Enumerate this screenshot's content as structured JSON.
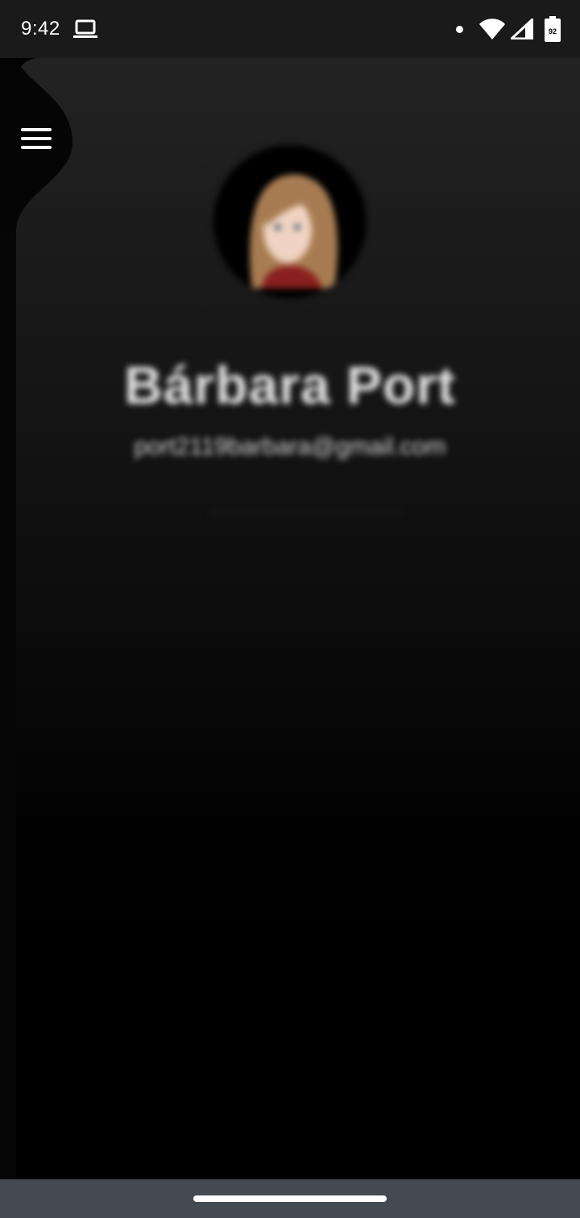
{
  "status_bar": {
    "time": "9:42",
    "icons": [
      "laptop-icon",
      "dot-icon",
      "wifi-icon",
      "signal-icon",
      "battery-icon"
    ],
    "battery_level": "92"
  },
  "drawer": {
    "menu_icon": "hamburger-menu-icon"
  },
  "profile": {
    "name": "Bárbara Port",
    "email": "port2119barbara@gmail.com"
  },
  "colors": {
    "status_bar_bg": "#1a1a1a",
    "nav_bar_bg": "#444a52",
    "text": "#e6e6e6"
  }
}
